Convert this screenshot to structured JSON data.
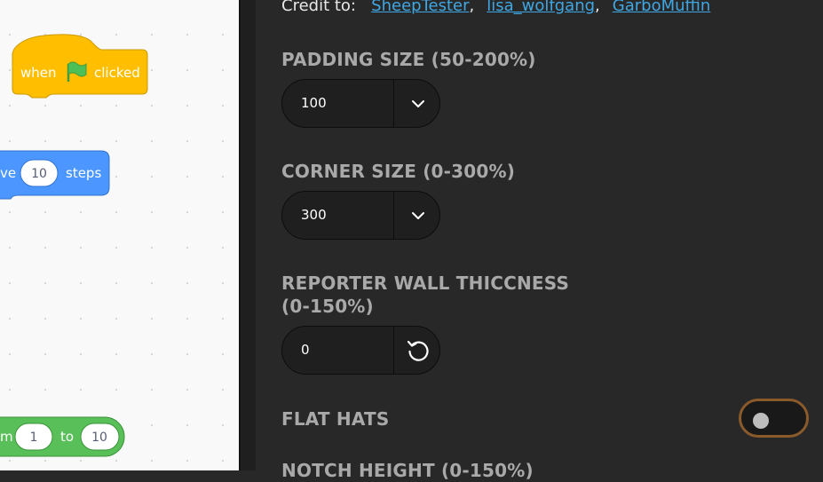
{
  "workspace": {
    "hat_block": {
      "when": "when",
      "clicked": "clicked",
      "color": "#ffbf00",
      "flag_color": "#4cbf56"
    },
    "motion_block": {
      "prefix": "ve",
      "value": "10",
      "suffix": "steps",
      "color": "#4c97ff"
    },
    "operator_block": {
      "prefix": "m",
      "from_value": "1",
      "to_label": "to",
      "to_value": "10",
      "color": "#59c059"
    }
  },
  "credits": {
    "label": "Credit to:",
    "names": [
      "SheepTester",
      "lisa_wolfgang",
      "GarboMuffin"
    ],
    "separator": ",",
    "link_color": "#3fa7e4"
  },
  "settings": {
    "padding": {
      "label": "PADDING SIZE (50-200%)",
      "value": "100"
    },
    "corner": {
      "label": "CORNER SIZE (0-300%)",
      "value": "300"
    },
    "wall": {
      "label_line1": "REPORTER WALL THICCNESS",
      "label_line2": "(0-150%)",
      "value": "0"
    },
    "flat_hats": {
      "label": "FLAT HATS",
      "enabled": false,
      "toggle_border": "#8a5a2b"
    },
    "notch": {
      "label": "NOTCH HEIGHT (0-150%)"
    }
  }
}
